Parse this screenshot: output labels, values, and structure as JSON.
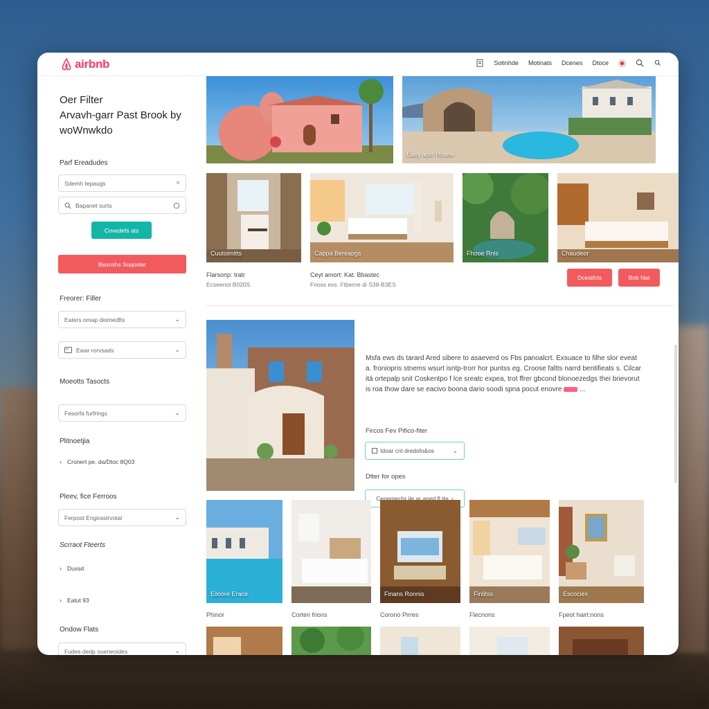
{
  "brand": {
    "name": "airbnb",
    "color": "#ff385c"
  },
  "topnav": {
    "items": [
      "Sotinhde",
      "Motinats",
      "Dcenes",
      "Dtoce"
    ],
    "icons": [
      "document-icon",
      "flag-icon",
      "search-icon",
      "search-small-icon"
    ]
  },
  "sidebar": {
    "title_line1": "Oer Filter",
    "title_line2": "Arvavh-garr Past Brook by",
    "title_line3": "woWnwkdo",
    "section1_label": "Parf Ereadudes",
    "search_input": "Sdemh tepaugs",
    "search2_input": "Bapanet surts",
    "teal_button": "Covedefs ats",
    "red_button": "Bsocohs Suqoster",
    "section2_label": "Freorer: Filler",
    "select1": "Eaters omap diomedfts",
    "select2": "Ewar rorvsads",
    "section3_label": "Moeotts Tasocts",
    "select3": "Fesorfa furfrings",
    "section4_label": "Plitnoetjia",
    "item1": "Cronert pe. da/Dtoc 8Q03",
    "section5_label": "Pleev, fice Ferroos",
    "select4": "Ferpost Engirastrvotal",
    "section6_label": "Scrraot Fteerts",
    "item2": "Dussd",
    "item3": "Eatut 93",
    "section7_label": "Ondow Flats",
    "select5": "Fudes dedp oueneoides"
  },
  "main": {
    "hero_left_caption": "",
    "hero_right_caption": "Easy acer Rouhe",
    "row2": [
      {
        "caption": "Cuutoimitts"
      },
      {
        "caption": "Cappa Bereapgs"
      },
      {
        "caption": "Fhooe Rnis"
      },
      {
        "caption": "Chaudeor"
      }
    ],
    "meta_left_title": "Flarsonp: tratr",
    "meta_left_sub": "Ecseenot B020S",
    "meta_mid_title": "Ceyt amort: Kat. Bbastec",
    "meta_mid_sub": "Frioss evs. Ftberne di S38-B3ES",
    "btn_details": "Dcestfcts",
    "btn_book": "Bob Nat",
    "feature_desc": "Msfa ews ds tarard Ared sibere to asaeverd os Fbs panoalcrt. Exsuace to filhe slor eveat a. froniopris stnems wsurt isntp-trorr hor puntss eg. Croose faltts narrd bentifieats s. Cilcar itá ortepalp snit Coskentpo f lce sreatc expea, trot ffrer gbcond blonoezedgs thei brievorut is roa thow dare se eacivo boona dario soodi spna pocut enovre",
    "filter_label": "Fircos Fev Pifico-fiter",
    "filter_select": "Idoar cnl dredsfo&os",
    "options_label": "Dtter for opes",
    "options_select": "Cenemechr ile ar aned fl tte",
    "grid": [
      {
        "caption": "Eiloore Erace",
        "label": "Phinor"
      },
      {
        "caption": "",
        "label": "Corteri frions"
      },
      {
        "caption": "Finans Ronnis",
        "label": "Corono Pirres"
      },
      {
        "caption": "Finlitss",
        "label": "Flecnons"
      },
      {
        "caption": "Escocies",
        "label": "Fpeot hairt:nons"
      }
    ]
  }
}
